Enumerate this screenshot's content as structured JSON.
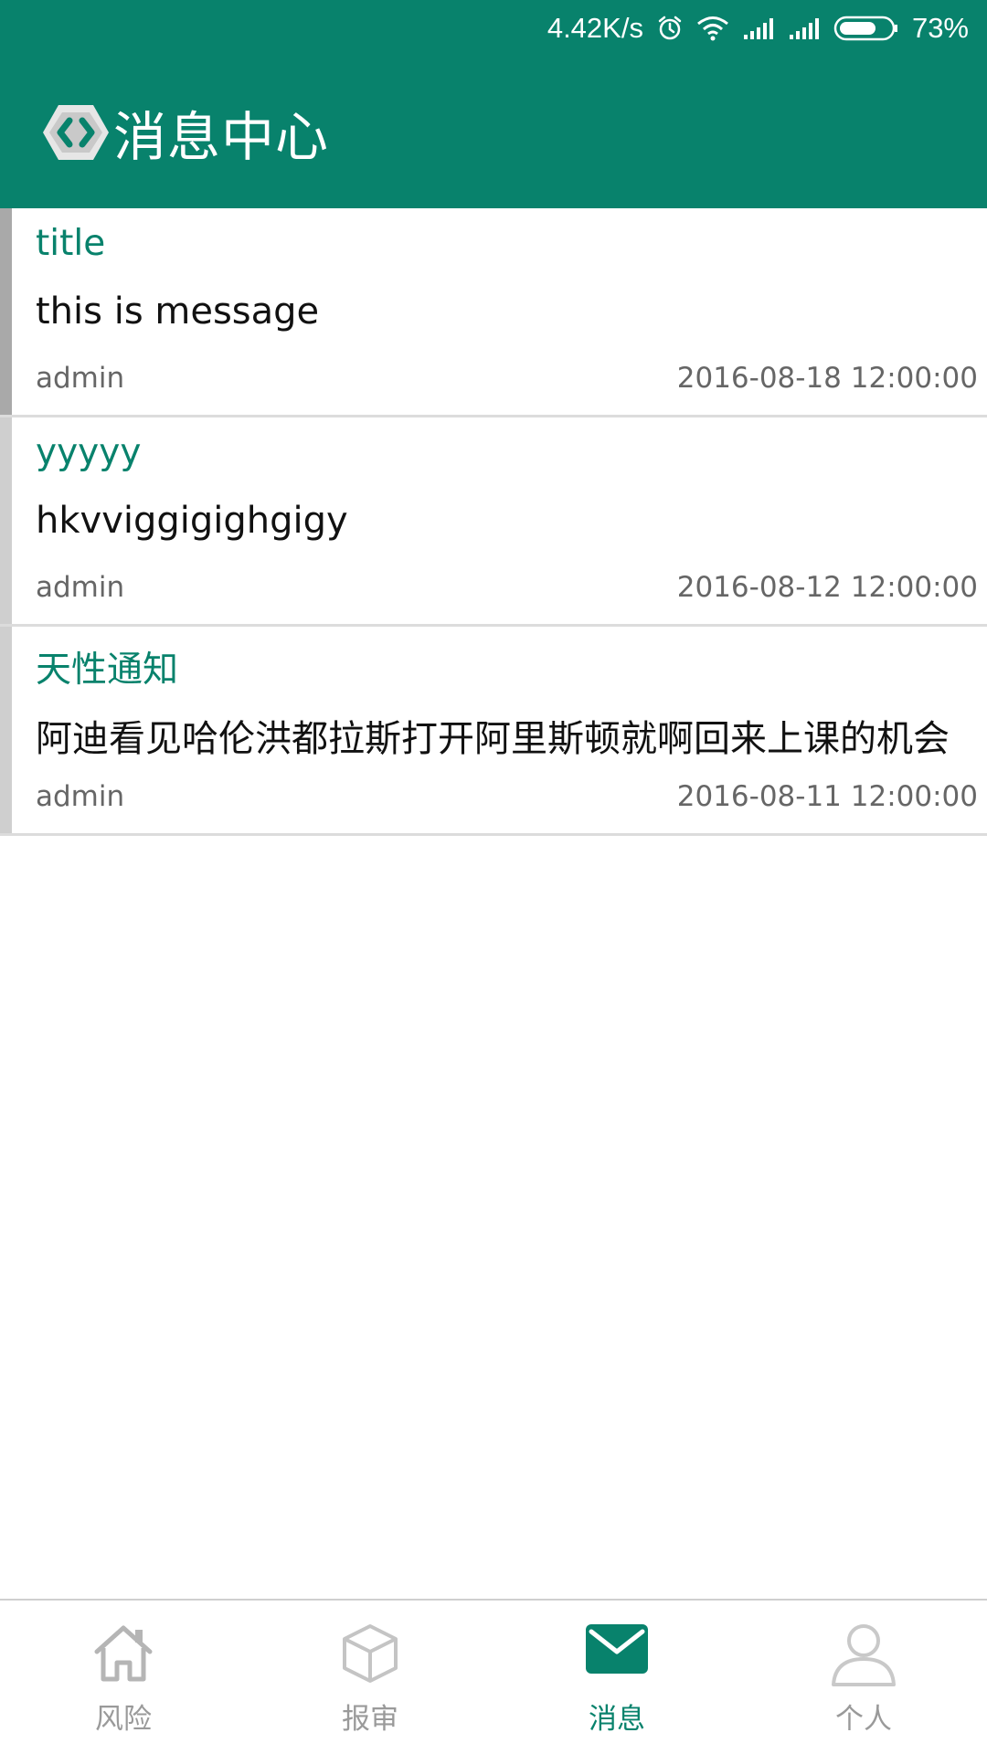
{
  "status_bar": {
    "speed": "4.42K/s",
    "battery": "73%",
    "battery_level": 0.73,
    "icons": [
      "alarm-icon",
      "wifi-icon",
      "signal-icon",
      "signal-icon",
      "battery-icon"
    ]
  },
  "app_bar": {
    "title": "消息中心",
    "logo_icon": "app-logo-icon"
  },
  "messages": [
    {
      "title": "title",
      "body": "this is message",
      "author": "admin",
      "date": "2016-08-18 12:00:00"
    },
    {
      "title": "yyyyy",
      "body": "hkvviggigighgigy",
      "author": "admin",
      "date": "2016-08-12 12:00:00"
    },
    {
      "title": "天性通知",
      "body": "阿迪看见哈伦洪都拉斯打开阿里斯顿就啊回来上课的机会",
      "author": "admin",
      "date": "2016-08-11 12:00:00"
    }
  ],
  "bottom_nav": {
    "active_index": 2,
    "tabs": [
      {
        "label": "风险",
        "icon": "home-icon"
      },
      {
        "label": "报审",
        "icon": "box-icon"
      },
      {
        "label": "消息",
        "icon": "mail-icon"
      },
      {
        "label": "个人",
        "icon": "person-icon"
      }
    ]
  },
  "colors": {
    "brand": "#08826c",
    "inactive": "#9a9a9a",
    "text": "#111111",
    "meta": "#666666",
    "divider": "#dcdcdc"
  }
}
